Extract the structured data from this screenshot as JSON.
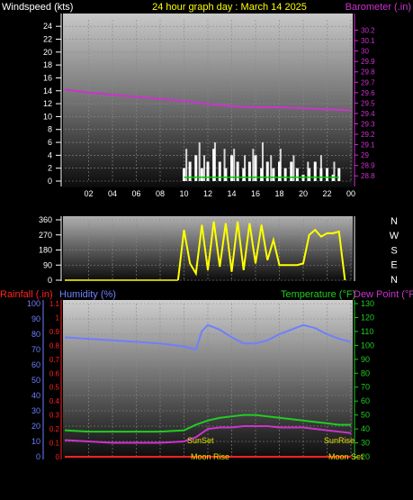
{
  "header": {
    "left": "Windspeed (kts)",
    "center": "24 hour graph day : March 14 2025",
    "right": "Barometer (.in)"
  },
  "labels": {
    "rainfall": "Rainfall (.in)",
    "humidity": "Humidity (%)",
    "temperature": "Temperature (°F)",
    "dewpoint": "Dew Point (°F)",
    "sunset": "SunSet",
    "sunrise": "SunRise",
    "moonrise": "Moon Rise",
    "moonset": "Moon Set"
  },
  "colors": {
    "windspeed": "#ffffff",
    "gust": "#d9d9d9",
    "barometer": "#cc33cc",
    "direction": "#ffff00",
    "humidity": "#6f7fff",
    "temperature": "#22cc22",
    "dewpoint": "#cc33cc",
    "rainfall": "#ff2222",
    "windAvg": "#00cc00"
  },
  "chart_data": [
    {
      "type": "line",
      "name": "wind-baro",
      "x_ticks": [
        "02",
        "04",
        "06",
        "08",
        "10",
        "12",
        "14",
        "16",
        "18",
        "20",
        "22",
        "00"
      ],
      "y_left_ticks": [
        "0",
        "2",
        "4",
        "6",
        "8",
        "10",
        "12",
        "14",
        "16",
        "18",
        "20",
        "22",
        "24"
      ],
      "y_right_ticks": [
        "28.8",
        "28.9",
        "29",
        "29.1",
        "29.2",
        "29.3",
        "29.4",
        "29.5",
        "29.6",
        "29.7",
        "29.8",
        "29.9",
        "30",
        "30.1",
        "30.2"
      ],
      "ylim_left": [
        0,
        25
      ],
      "ylim_right": [
        28.75,
        30.3
      ],
      "barometer": {
        "x": [
          0,
          2,
          4,
          6,
          8,
          10,
          12,
          14,
          16,
          18,
          20,
          22,
          24
        ],
        "y": [
          29.63,
          29.6,
          29.58,
          29.56,
          29.54,
          29.52,
          29.49,
          29.47,
          29.46,
          29.46,
          29.45,
          29.44,
          29.43
        ]
      },
      "windspeed": {
        "x": [
          10,
          10.5,
          11,
          11.5,
          12,
          12.5,
          13,
          13.5,
          14,
          14.5,
          15,
          15.5,
          16,
          16.5,
          17,
          17.5,
          18,
          18.5,
          19,
          19.5,
          20,
          20.5,
          21,
          21.5,
          22,
          22.5,
          23
        ],
        "y": [
          2,
          3,
          4,
          2,
          3,
          5,
          3,
          2,
          4,
          3,
          2,
          3,
          4,
          2,
          3,
          2,
          3,
          2,
          3,
          2,
          1,
          2,
          3,
          2,
          2,
          1,
          2
        ]
      },
      "gust": {
        "x": [
          10.2,
          11.3,
          11.7,
          12.6,
          13.4,
          14.2,
          15.1,
          15.8,
          16.6,
          17.3,
          18.1,
          19.2,
          20.4,
          21.5,
          22.6
        ],
        "y": [
          5,
          6,
          4,
          6,
          5,
          5,
          4,
          5,
          6,
          4,
          5,
          4,
          3,
          4,
          3
        ]
      }
    },
    {
      "type": "line",
      "name": "wind-direction",
      "y_ticks": [
        "360",
        "270",
        "180",
        "90",
        "0"
      ],
      "ylim": [
        0,
        360
      ],
      "compass": [
        "N",
        "W",
        "S",
        "E",
        "N"
      ],
      "direction": {
        "x": [
          9.5,
          10.0,
          10.5,
          11,
          11.5,
          12,
          12.5,
          13,
          13.5,
          14,
          14.5,
          15,
          15.5,
          16,
          16.5,
          17,
          17.5,
          18,
          18.5,
          19,
          19.5,
          20,
          20.5,
          21,
          21.5,
          22,
          22.5,
          23,
          23.5
        ],
        "y": [
          0,
          300,
          100,
          40,
          330,
          60,
          350,
          80,
          340,
          50,
          350,
          60,
          340,
          100,
          330,
          120,
          240,
          90,
          90,
          90,
          90,
          100,
          270,
          300,
          260,
          280,
          280,
          290,
          0
        ]
      }
    },
    {
      "type": "line",
      "name": "humidity-temp",
      "y_humidity_ticks": [
        "0",
        "10",
        "20",
        "30",
        "40",
        "50",
        "60",
        "70",
        "80",
        "90",
        "100"
      ],
      "y_rain_ticks": [
        "0",
        "0.1",
        "0.2",
        "0.3",
        "0.4",
        "0.5",
        "0.6",
        "0.7",
        "0.8",
        "0.9",
        "1",
        "1.1"
      ],
      "y_temp_ticks": [
        "20",
        "30",
        "40",
        "50",
        "60",
        "70",
        "80",
        "90",
        "100",
        "110",
        "120",
        "130"
      ],
      "humidity_ylim": [
        0,
        100
      ],
      "temp_ylim": [
        20,
        130
      ],
      "humidity": {
        "x": [
          0,
          2,
          4,
          6,
          8,
          10,
          11,
          11.5,
          12,
          13,
          14,
          15,
          16,
          17,
          18,
          19,
          20,
          21,
          22,
          23,
          24
        ],
        "y": [
          78,
          77,
          76,
          75,
          74,
          72,
          70,
          82,
          86,
          83,
          78,
          74,
          74,
          76,
          80,
          83,
          86,
          84,
          80,
          77,
          75
        ]
      },
      "temperature": {
        "x": [
          0,
          2,
          4,
          6,
          8,
          10,
          11,
          12,
          13,
          14,
          15,
          16,
          17,
          18,
          19,
          20,
          21,
          22,
          23,
          24
        ],
        "y": [
          39,
          38,
          38,
          38,
          38,
          39,
          43,
          46,
          48,
          49,
          50,
          50,
          49,
          48,
          47,
          46,
          45,
          44,
          43,
          43
        ]
      },
      "dewpoint": {
        "x": [
          0,
          2,
          4,
          6,
          8,
          10,
          11,
          12,
          13,
          14,
          15,
          16,
          17,
          18,
          19,
          20,
          21,
          22,
          23,
          24
        ],
        "y": [
          32,
          31,
          30,
          30,
          30,
          31,
          34,
          40,
          41,
          41,
          42,
          42,
          42,
          41,
          41,
          41,
          40,
          39,
          38,
          37
        ]
      },
      "rainfall": {
        "x": [
          0,
          24
        ],
        "y": [
          0,
          0
        ]
      }
    }
  ]
}
